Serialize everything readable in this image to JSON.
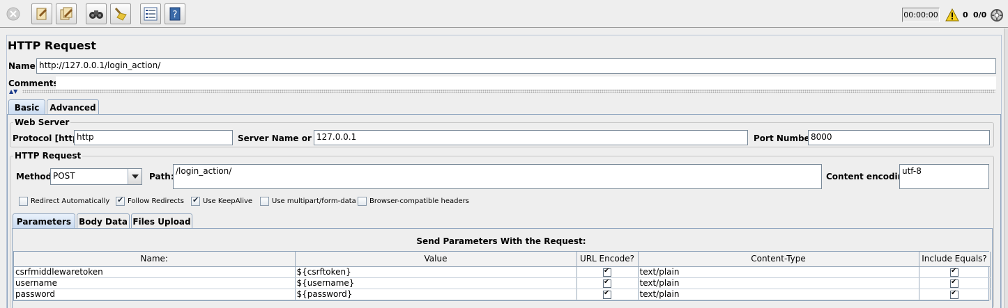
{
  "toolbar": {
    "timer": "00:00:00",
    "warning_count": "0",
    "threads": "0/0",
    "icons": [
      "stop-icon",
      "clear-icon",
      "clear-all-icon",
      "search-icon",
      "reset-search-icon",
      "function-helper-icon",
      "help-icon",
      "warning-icon",
      "remote-icon"
    ]
  },
  "panel": {
    "title": "HTTP Request",
    "name_label": "Name:",
    "name_value": "http://127.0.0.1/login_action/",
    "comments_label": "Comments:"
  },
  "tabs": [
    "Basic",
    "Advanced"
  ],
  "web_server": {
    "title": "Web Server",
    "protocol_label": "Protocol [http]:",
    "protocol_value": "http",
    "server_label": "Server Name or IP:",
    "server_value": "127.0.0.1",
    "port_label": "Port Number:",
    "port_value": "8000"
  },
  "http_request": {
    "title": "HTTP Request",
    "method_label": "Method:",
    "method_value": "POST",
    "path_label": "Path:",
    "path_value": "/login_action/",
    "encoding_label": "Content encoding:",
    "encoding_value": "utf-8",
    "options": [
      {
        "label": "Redirect Automatically",
        "checked": false
      },
      {
        "label": "Follow Redirects",
        "checked": true
      },
      {
        "label": "Use KeepAlive",
        "checked": true
      },
      {
        "label": "Use multipart/form-data",
        "checked": false
      },
      {
        "label": "Browser-compatible headers",
        "checked": false
      }
    ]
  },
  "sub_tabs": [
    "Parameters",
    "Body Data",
    "Files Upload"
  ],
  "params": {
    "caption": "Send Parameters With the Request:",
    "columns": [
      "Name:",
      "Value",
      "URL Encode?",
      "Content-Type",
      "Include Equals?"
    ],
    "rows": [
      {
        "name": "csrfmiddlewaretoken",
        "value": "${csrftoken}",
        "content_type": "text/plain"
      },
      {
        "name": "username",
        "value": "${username}",
        "content_type": "text/plain"
      },
      {
        "name": "password",
        "value": "${password}",
        "content_type": "text/plain"
      }
    ]
  },
  "colors": {
    "tab_active": "#c9daf0",
    "border": "#8ea4be"
  }
}
